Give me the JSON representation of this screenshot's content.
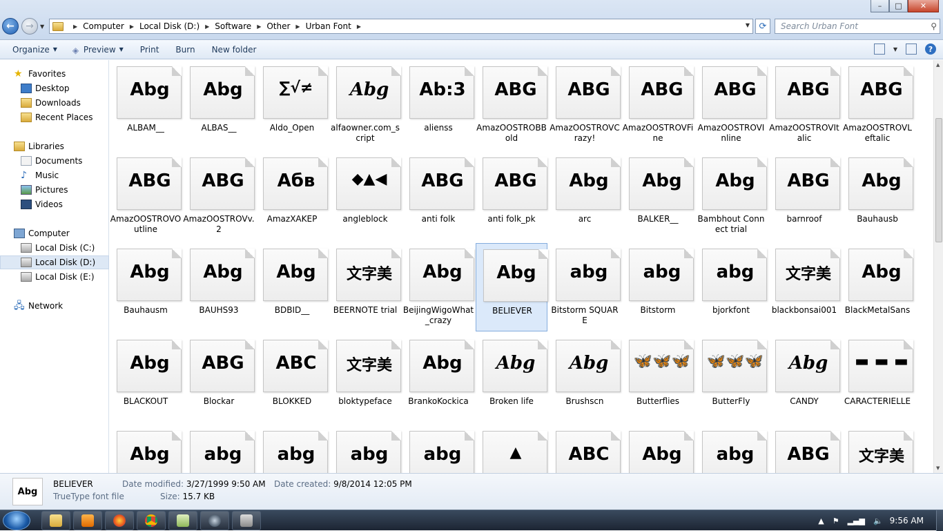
{
  "window": {
    "caption_buttons": {
      "minimize": "–",
      "maximize": "□",
      "close": "✕"
    }
  },
  "address": {
    "crumbs": [
      "Computer",
      "Local Disk (D:)",
      "Software",
      "Other",
      "Urban Font"
    ]
  },
  "search": {
    "placeholder": "Search Urban Font"
  },
  "toolbar": {
    "organize": "Organize",
    "preview": "Preview",
    "print": "Print",
    "burn": "Burn",
    "new_folder": "New folder"
  },
  "nav": {
    "favorites": "Favorites",
    "desktop": "Desktop",
    "downloads": "Downloads",
    "recent_places": "Recent Places",
    "libraries": "Libraries",
    "documents": "Documents",
    "music": "Music",
    "pictures": "Pictures",
    "videos": "Videos",
    "computer": "Computer",
    "local_c": "Local Disk (C:)",
    "local_d": "Local Disk (D:)",
    "local_e": "Local Disk (E:)",
    "network": "Network"
  },
  "files": [
    {
      "name": "ALBAM__",
      "glyph": "Abg"
    },
    {
      "name": "ALBAS__",
      "glyph": "Abg"
    },
    {
      "name": "Aldo_Open",
      "glyph": "∑√≠"
    },
    {
      "name": "alfaowner.com_script",
      "glyph": "Abg"
    },
    {
      "name": "alienss",
      "glyph": "Ab:3"
    },
    {
      "name": "AmazOOSTROBBold",
      "glyph": "ABG"
    },
    {
      "name": "AmazOOSTROVCrazy!",
      "glyph": "ABG"
    },
    {
      "name": "AmazOOSTROVFine",
      "glyph": "ABG"
    },
    {
      "name": "AmazOOSTROVInline",
      "glyph": "ABG"
    },
    {
      "name": "AmazOOSTROVItalic",
      "glyph": "ABG"
    },
    {
      "name": "AmazOOSTROVLeftalic",
      "glyph": "ABG"
    },
    {
      "name": "AmazOOSTROVOutline",
      "glyph": "ABG"
    },
    {
      "name": "AmazOOSTROVv.2",
      "glyph": "ABG"
    },
    {
      "name": "AmazXAKEP",
      "glyph": "Aбв"
    },
    {
      "name": "angleblock",
      "glyph": "◆▲◀"
    },
    {
      "name": "anti folk",
      "glyph": "ABG"
    },
    {
      "name": "anti folk_pk",
      "glyph": "ABG"
    },
    {
      "name": "arc",
      "glyph": "Abg"
    },
    {
      "name": "BALKER__",
      "glyph": "Abg"
    },
    {
      "name": "Bambhout Connect trial",
      "glyph": "Abg"
    },
    {
      "name": "barnroof",
      "glyph": "ABG"
    },
    {
      "name": "Bauhausb",
      "glyph": "Abg"
    },
    {
      "name": "Bauhausm",
      "glyph": "Abg"
    },
    {
      "name": "BAUHS93",
      "glyph": "Abg"
    },
    {
      "name": "BDBID__",
      "glyph": "Abg"
    },
    {
      "name": "BEERNOTE trial",
      "glyph": "文字美"
    },
    {
      "name": "BeijingWigoWhat_crazy",
      "glyph": "Abg"
    },
    {
      "name": "BELIEVER",
      "glyph": "Abg"
    },
    {
      "name": "Bitstorm SQUARE",
      "glyph": "abg"
    },
    {
      "name": "Bitstorm",
      "glyph": "abg"
    },
    {
      "name": "bjorkfont",
      "glyph": "abg"
    },
    {
      "name": "blackbonsai001",
      "glyph": "文字美"
    },
    {
      "name": "BlackMetalSans",
      "glyph": "Abg"
    },
    {
      "name": "BLACKOUT",
      "glyph": "Abg"
    },
    {
      "name": "Blockar",
      "glyph": "ABG"
    },
    {
      "name": "BLOKKED",
      "glyph": "ABC"
    },
    {
      "name": "bloktypeface",
      "glyph": "文字美"
    },
    {
      "name": "BrankoKockica",
      "glyph": "Abg"
    },
    {
      "name": "Broken life",
      "glyph": "Abg"
    },
    {
      "name": "Brushscn",
      "glyph": "Abg"
    },
    {
      "name": "Butterflies",
      "glyph": "🦋🦋🦋"
    },
    {
      "name": "ButterFly",
      "glyph": "🦋🦋🦋"
    },
    {
      "name": "CANDY",
      "glyph": "Abg"
    },
    {
      "name": "CARACTERIELLE",
      "glyph": "▬ ▬ ▬"
    },
    {
      "name": "",
      "glyph": "Abg"
    },
    {
      "name": "",
      "glyph": "abg"
    },
    {
      "name": "",
      "glyph": "abg"
    },
    {
      "name": "",
      "glyph": "abg"
    },
    {
      "name": "",
      "glyph": "abg"
    },
    {
      "name": "",
      "glyph": "▲"
    },
    {
      "name": "",
      "glyph": "ABC"
    },
    {
      "name": "",
      "glyph": "Abg"
    },
    {
      "name": "",
      "glyph": "abg"
    },
    {
      "name": "",
      "glyph": "ABG"
    },
    {
      "name": "",
      "glyph": "文字美"
    }
  ],
  "selected_index": 27,
  "details": {
    "name": "BELIEVER",
    "type": "TrueType font file",
    "date_modified_label": "Date modified:",
    "date_modified": "3/27/1999 9:50 AM",
    "date_created_label": "Date created:",
    "date_created": "9/8/2014 12:05 PM",
    "size_label": "Size:",
    "size": "15.7 KB",
    "thumb_glyph": "Abg"
  },
  "taskbar": {
    "clock": "9:56 AM",
    "apps": [
      "explorer-icon",
      "media-player-icon",
      "firefox-icon",
      "chrome-icon",
      "files-icon",
      "steam-icon",
      "app-icon"
    ]
  },
  "colors": {
    "selection": "#dbe9fa",
    "accent": "#1e395b"
  }
}
